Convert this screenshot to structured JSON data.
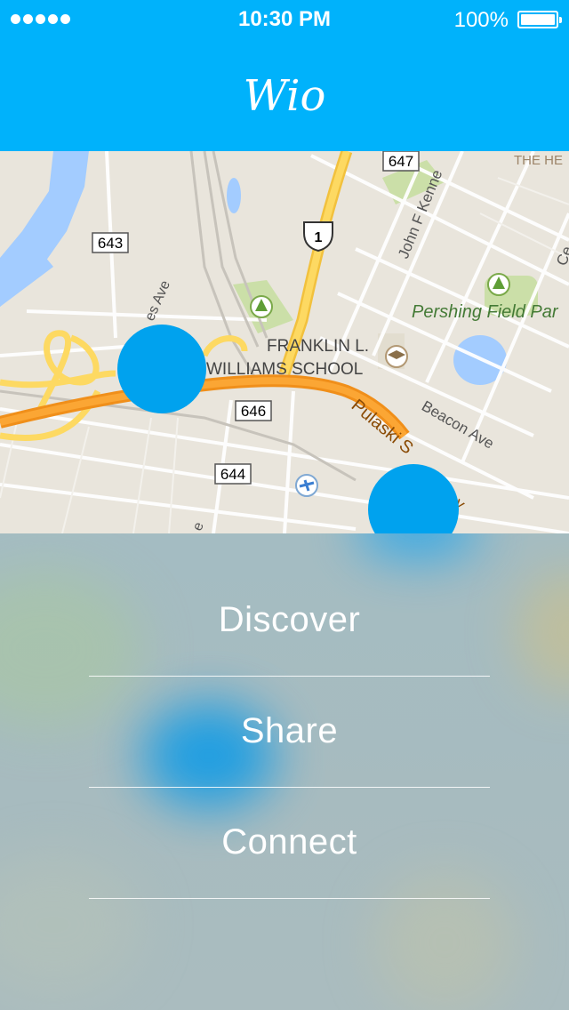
{
  "status_bar": {
    "time": "10:30 PM",
    "battery_percent": "100%",
    "signal_icon": "signal-dots-icon",
    "battery_icon": "battery-icon"
  },
  "header": {
    "title": "Wio",
    "color": "#00b2fb"
  },
  "map": {
    "labels": {
      "road_647": "647",
      "road_643": "643",
      "road_646": "646",
      "road_644": "644",
      "us_route": "1",
      "john_f_kennedy": "John F Kenne",
      "es_ave": "es Ave",
      "franklin_line1": "FRANKLIN L.",
      "franklin_line2": "WILLIAMS SCHOOL",
      "pershing_field": "Pershing Field Par",
      "beacon_ave": "Beacon Ave",
      "pulaski": "Pulaski S",
      "the_he": "THE HE",
      "ce": "Ce",
      "y_fragment": "y",
      "e_fragment": "e"
    },
    "marker_color": "#00a2ee"
  },
  "menu": {
    "items": [
      {
        "label": "Discover"
      },
      {
        "label": "Share"
      },
      {
        "label": "Connect"
      }
    ]
  }
}
